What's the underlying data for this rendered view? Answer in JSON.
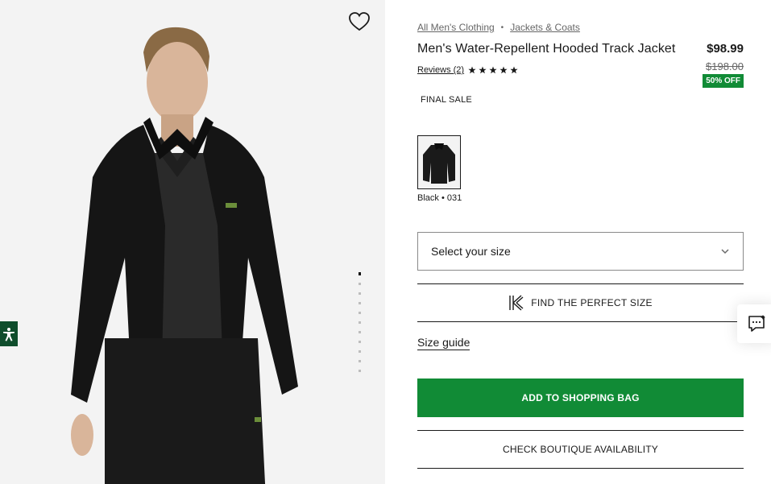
{
  "breadcrumb": {
    "items": [
      "All Men's Clothing",
      "Jackets & Coats"
    ],
    "separator": "•"
  },
  "product": {
    "title": "Men's Water-Repellent Hooded Track Jacket",
    "price": "$98.99",
    "original_price": "$198.00",
    "discount": "50% OFF",
    "reviews_label": "Reviews (2)",
    "rating_stars": 5,
    "final_sale": "FINAL SALE",
    "color_label": "Black • 031"
  },
  "size": {
    "placeholder": "Select your size"
  },
  "actions": {
    "perfect_size": "FIND THE PERFECT SIZE",
    "size_guide": "Size guide",
    "add_to_bag": "ADD TO SHOPPING BAG",
    "boutique": "CHECK BOUTIQUE AVAILABILITY"
  },
  "gallery": {
    "image_count": 11,
    "active_index": 0
  },
  "colors": {
    "brand_green": "#118b36",
    "accessibility_bg": "#0f4d2c"
  },
  "icons": [
    "heart-icon",
    "accessibility-icon",
    "star-icon",
    "chevron-down-icon",
    "perfect-size-k-icon",
    "chat-icon"
  ]
}
